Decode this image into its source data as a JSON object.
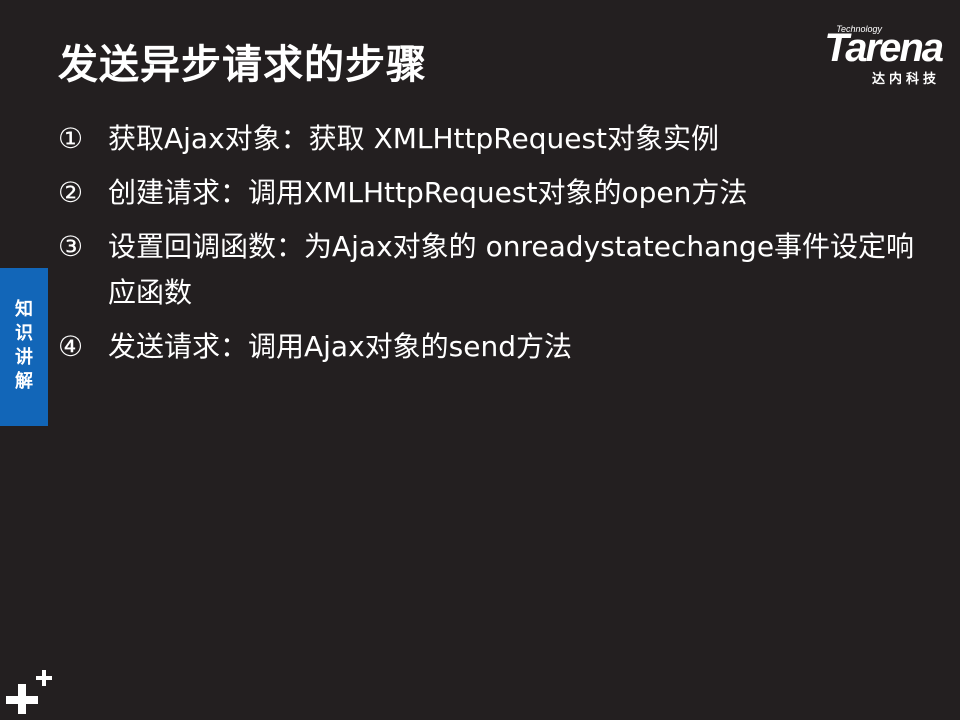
{
  "slide": {
    "title": "发送异步请求的步骤",
    "logo": {
      "tag": "Technology",
      "wordmark": "Tarena",
      "subtitle": "达内科技"
    },
    "side_tab_label": "知识讲解",
    "steps": [
      {
        "number": "①",
        "text": "获取Ajax对象：获取 XMLHttpRequest对象实例"
      },
      {
        "number": "②",
        "text": "创建请求：调用XMLHttpRequest对象的open方法"
      },
      {
        "number": "③",
        "text": "设置回调函数：为Ajax对象的  onreadystatechange事件设定响应函数"
      },
      {
        "number": "④",
        "text": "发送请求：调用Ajax对象的send方法"
      }
    ]
  },
  "colors": {
    "background": "#231f20",
    "side_tab": "#1266b8",
    "text": "#ffffff"
  },
  "icons": {
    "corner_mark": "plus-icon"
  }
}
